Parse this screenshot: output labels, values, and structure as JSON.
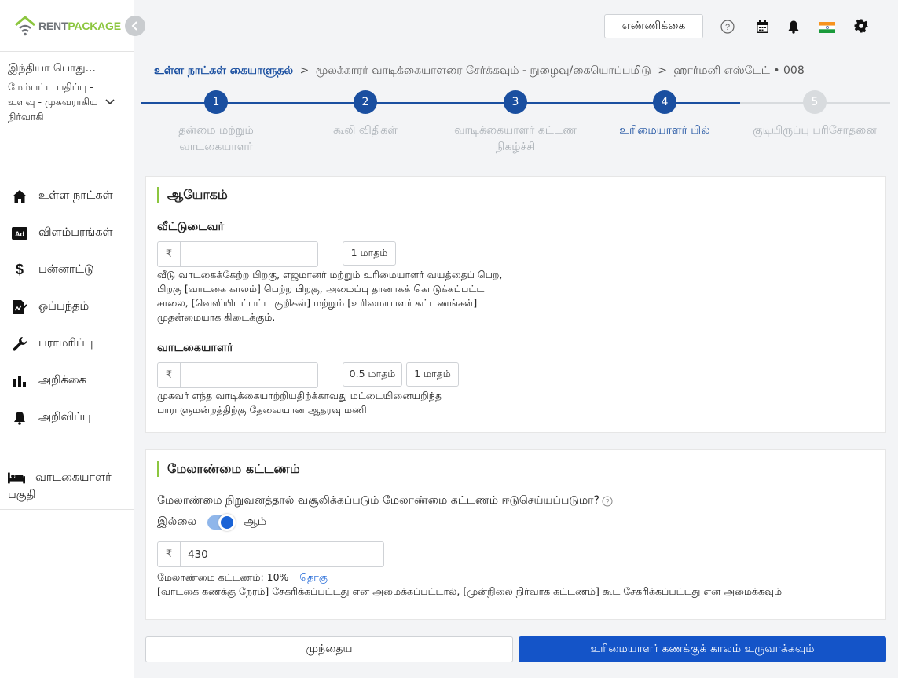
{
  "brand": {
    "rent": "RENT",
    "package": "PACKAGE",
    "accent": "#8cc63f",
    "primary": "#1454c8"
  },
  "user": {
    "org": "இந்தியா பொது...",
    "role": "மேம்பட்ட பதிப்பு - உளவு - முகவராகிய நிர்வாகி"
  },
  "nav": [
    {
      "label": "உள்ள நாட்கள்",
      "icon": "home-icon"
    },
    {
      "label": "விளம்பரங்கள்",
      "icon": "ad-icon"
    },
    {
      "label": "பன்னாட்டு",
      "icon": "dollar-icon"
    },
    {
      "label": "ஒப்பந்தம்",
      "icon": "contract-icon"
    },
    {
      "label": "பராமரிப்பு",
      "icon": "wrench-icon"
    },
    {
      "label": "அறிக்கை",
      "icon": "chart-icon"
    },
    {
      "label": "அறிவிப்பு",
      "icon": "bell-icon"
    }
  ],
  "nav_bottom": {
    "label": "வாடகையாளர் பகுதி",
    "icon": "bed-icon"
  },
  "topbar": {
    "count_label": "எண்ணிக்கை"
  },
  "breadcrumb": {
    "link": "உள்ள நாட்கள் கையாளுதல்",
    "sep": ">",
    "middle": "மூலக்காரர் வாடிக்கையாளரை சேர்க்கவும் - நுழைவு/கையொப்பமிடு",
    "last": "ஹார்மனி எஸ்டேட் • 008"
  },
  "steps": [
    {
      "num": "1",
      "label": "தன்மை மற்றும் வாடகையாளர்",
      "state": "done"
    },
    {
      "num": "2",
      "label": "கூலி விதிகள்",
      "state": "done"
    },
    {
      "num": "3",
      "label": "வாடிக்கையாளர் கட்டண நிகழ்ச்சி",
      "state": "done"
    },
    {
      "num": "4",
      "label": "உரிமையாளர் பில்",
      "state": "active"
    },
    {
      "num": "5",
      "label": "குடியிருப்பு பரிசோதனை",
      "state": "pending"
    }
  ],
  "commission": {
    "title": "ஆயோகம்",
    "landlord": {
      "label": "வீட்டுடைவர்",
      "currency": "₹",
      "value": "",
      "chips": [
        "1 மாதம்"
      ],
      "help": "வீடு வாடகைக்கேற்ற பிறகு, எஜமானர் மற்றும் உரிமையாளர் வயத்தைப் பெற, பிறகு [வாடகை காலம்] பெற்ற பிறகு, அமைப்பு தானாகக் கொடுக்கப்பட்ட சாலை, [வெளியிடப்பட்ட குறிகள்] மற்றும் [உரிமையாளர் கட்டணங்கள்] முதன்மையாக கிடைக்கும்."
    },
    "tenant": {
      "label": "வாடகையாளர்",
      "currency": "₹",
      "value": "",
      "chips": [
        "0.5 மாதம்",
        "1 மாதம்"
      ],
      "help": "முகவர் எந்த வாடிக்கையாற்றியதிற்க்காவது மட்டையினையறிந்த பாராளுமன்றத்திற்கு தேவையான ஆதரவு மணி"
    }
  },
  "management": {
    "title": "மேலாண்மை கட்டணம்",
    "question": "மேலாண்மை நிறுவனத்தால் வசூலிக்கப்படும் மேலாண்மை கட்டணம் ஈடுசெய்யப்படுமா?",
    "no_label": "இல்லை",
    "yes_label": "ஆம்",
    "toggle_on": true,
    "currency": "₹",
    "value": "430",
    "fee_text": "மேலாண்மை கட்டணம்: 10%",
    "edit_link": "தொகு",
    "note": "[வாடகை கணக்கு நேரம்] சேகரிக்கப்பட்டது என அமைக்கப்பட்டால், [முன்நிலை நிர்வாக கட்டணம்] கூட சேகரிக்கப்பட்டது என அமைக்கவும்"
  },
  "footer": {
    "prev_label": "முந்தைய",
    "next_label": "உரிமையாளர் கணக்குக் காலம் உருவாக்கவும்"
  }
}
